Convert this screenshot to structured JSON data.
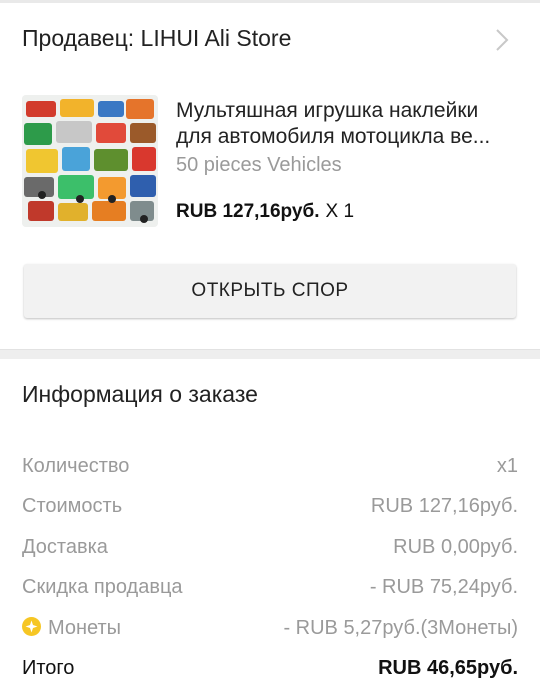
{
  "seller": {
    "label": "Продавец: LIHUI Ali Store"
  },
  "product": {
    "title_line1": "Мультяшная игрушка наклейки",
    "title_line2": "для автомобиля мотоцикла ве...",
    "variant": "50 pieces Vehicles",
    "price": "RUB 127,16руб.",
    "quantity": "X 1",
    "thumbnail_icon": "vehicle-stickers-thumbnail"
  },
  "dispute_button": {
    "label": "ОТКРЫТЬ СПОР"
  },
  "order_info": {
    "title": "Информация о заказе",
    "rows": [
      {
        "key": "Количество",
        "value": "x1"
      },
      {
        "key": "Стоимость",
        "value": "RUB 127,16руб."
      },
      {
        "key": "Доставка",
        "value": "RUB 0,00руб."
      },
      {
        "key": "Скидка продавца",
        "value": "- RUB 75,24руб."
      },
      {
        "key": "Монеты",
        "value": "- RUB 5,27руб.(3Монеты)",
        "icon": "coin-icon"
      },
      {
        "key": "Итого",
        "value": "RUB 46,65руб."
      }
    ]
  },
  "colors": {
    "muted_text": "#9a9a9a",
    "primary_text": "#222222",
    "coin": "#f6c624",
    "button_bg": "#f2f2f2",
    "separator": "#eeeeee"
  }
}
